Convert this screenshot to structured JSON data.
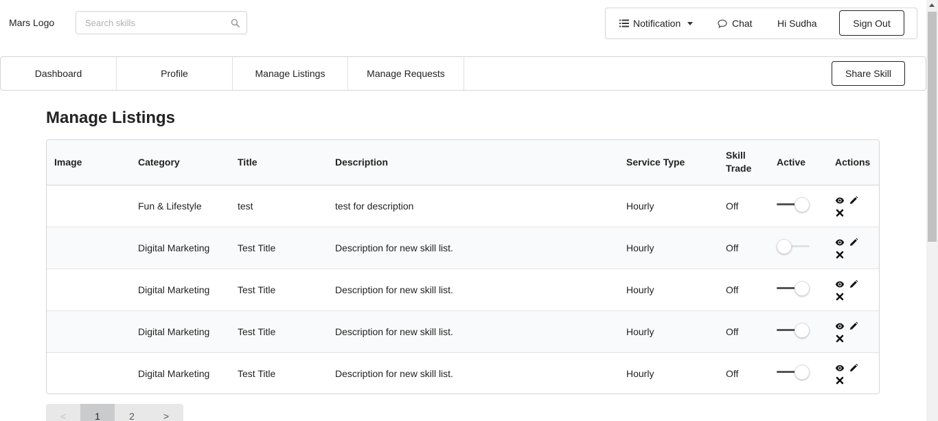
{
  "header": {
    "logo": "Mars Logo",
    "search_placeholder": "Search skills",
    "notification_label": "Notification",
    "chat_label": "Chat",
    "greeting": "Hi Sudha",
    "signout_label": "Sign Out"
  },
  "nav": {
    "tabs": [
      {
        "label": "Dashboard"
      },
      {
        "label": "Profile"
      },
      {
        "label": "Manage Listings"
      },
      {
        "label": "Manage Requests"
      }
    ],
    "share_label": "Share Skill"
  },
  "page": {
    "title": "Manage Listings"
  },
  "table": {
    "headers": {
      "image": "Image",
      "category": "Category",
      "title": "Title",
      "description": "Description",
      "service_type": "Service Type",
      "skill_trade": "Skill Trade",
      "active": "Active",
      "actions": "Actions"
    },
    "rows": [
      {
        "category": "Fun & Lifestyle",
        "title": "test",
        "description": "test for description",
        "service_type": "Hourly",
        "skill_trade": "Off",
        "active": true
      },
      {
        "category": "Digital Marketing",
        "title": "Test Title",
        "description": "Description for new skill list.",
        "service_type": "Hourly",
        "skill_trade": "Off",
        "active": false
      },
      {
        "category": "Digital Marketing",
        "title": "Test Title",
        "description": "Description for new skill list.",
        "service_type": "Hourly",
        "skill_trade": "Off",
        "active": true
      },
      {
        "category": "Digital Marketing",
        "title": "Test Title",
        "description": "Description for new skill list.",
        "service_type": "Hourly",
        "skill_trade": "Off",
        "active": true
      },
      {
        "category": "Digital Marketing",
        "title": "Test Title",
        "description": "Description for new skill list.",
        "service_type": "Hourly",
        "skill_trade": "Off",
        "active": true
      }
    ]
  },
  "pagination": {
    "prev": "<",
    "pages": [
      "1",
      "2"
    ],
    "next": ">",
    "current": "1"
  },
  "icons": {
    "search": "search-icon",
    "notification": "list-icon",
    "chat": "chat-bubble-icon",
    "view": "eye-icon",
    "edit": "pencil-icon",
    "delete": "close-icon"
  }
}
